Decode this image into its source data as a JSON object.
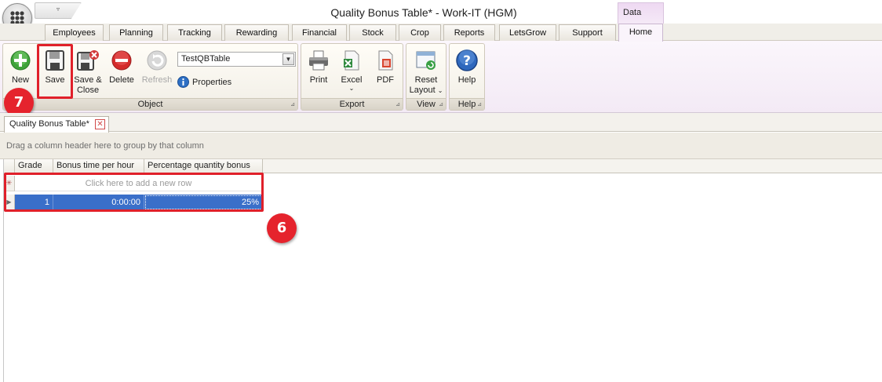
{
  "window": {
    "title": "Quality Bonus Table* - Work-IT (HGM)",
    "context_tab": "Data"
  },
  "quick_access": {
    "dropdown_glyph": "▿"
  },
  "ribbon": {
    "tabs": [
      {
        "label": "Employees"
      },
      {
        "label": "Planning"
      },
      {
        "label": "Tracking"
      },
      {
        "label": "Rewarding"
      },
      {
        "label": "Financial"
      },
      {
        "label": "Stock"
      },
      {
        "label": "Crop"
      },
      {
        "label": "Reports"
      },
      {
        "label": "LetsGrow"
      },
      {
        "label": "Support"
      },
      {
        "label": "Home"
      }
    ],
    "active_tab": "Home",
    "groups": {
      "object": {
        "label": "Object",
        "new": "New",
        "save": "Save",
        "save_close_1": "Save &",
        "save_close_2": "Close",
        "delete": "Delete",
        "refresh": "Refresh",
        "table_select": "TestQBTable",
        "properties": "Properties"
      },
      "export": {
        "label": "Export",
        "print": "Print",
        "excel": "Excel",
        "pdf": "PDF"
      },
      "view": {
        "label": "View",
        "reset_1": "Reset",
        "reset_2": "Layout"
      },
      "help": {
        "label": "Help",
        "help": "Help"
      }
    }
  },
  "document_tab": {
    "label": "Quality Bonus Table*"
  },
  "grid": {
    "group_hint": "Drag a column header here to group by that column",
    "columns": [
      "Grade",
      "Bonus time per hour",
      "Percentage quantity bonus"
    ],
    "new_row_hint": "Click here to add a new row",
    "rows": [
      {
        "grade": "1",
        "bonus_time": "0:00:00",
        "percentage": "25%"
      }
    ]
  },
  "callouts": {
    "save": "7",
    "grid": "6"
  },
  "colors": {
    "highlight": "#e0202a",
    "selection": "#3a6fc9"
  }
}
